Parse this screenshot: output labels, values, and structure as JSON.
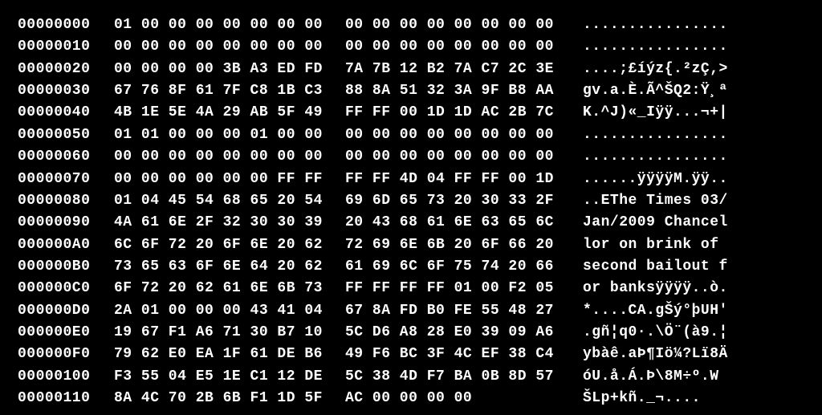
{
  "hexdump": {
    "rows": [
      {
        "offset": "00000000",
        "b1": "01 00 00 00 00 00 00 00",
        "b2": "00 00 00 00 00 00 00 00",
        "ascii": "................"
      },
      {
        "offset": "00000010",
        "b1": "00 00 00 00 00 00 00 00",
        "b2": "00 00 00 00 00 00 00 00",
        "ascii": "................"
      },
      {
        "offset": "00000020",
        "b1": "00 00 00 00 3B A3 ED FD",
        "b2": "7A 7B 12 B2 7A C7 2C 3E",
        "ascii": "....;£íýz{.²zÇ,>"
      },
      {
        "offset": "00000030",
        "b1": "67 76 8F 61 7F C8 1B C3",
        "b2": "88 8A 51 32 3A 9F B8 AA",
        "ascii": "gv.a.È.Ã^ŠQ2:Ÿ¸ª"
      },
      {
        "offset": "00000040",
        "b1": "4B 1E 5E 4A 29 AB 5F 49",
        "b2": "FF FF 00 1D 1D AC 2B 7C",
        "ascii": "K.^J)«_Iÿÿ...¬+|"
      },
      {
        "offset": "00000050",
        "b1": "01 01 00 00 00 01 00 00",
        "b2": "00 00 00 00 00 00 00 00",
        "ascii": "................"
      },
      {
        "offset": "00000060",
        "b1": "00 00 00 00 00 00 00 00",
        "b2": "00 00 00 00 00 00 00 00",
        "ascii": "................"
      },
      {
        "offset": "00000070",
        "b1": "00 00 00 00 00 00 FF FF",
        "b2": "FF FF 4D 04 FF FF 00 1D",
        "ascii": "......ÿÿÿÿM.ÿÿ.."
      },
      {
        "offset": "00000080",
        "b1": "01 04 45 54 68 65 20 54",
        "b2": "69 6D 65 73 20 30 33 2F",
        "ascii": "..EThe Times 03/"
      },
      {
        "offset": "00000090",
        "b1": "4A 61 6E 2F 32 30 30 39",
        "b2": "20 43 68 61 6E 63 65 6C",
        "ascii": "Jan/2009 Chancel"
      },
      {
        "offset": "000000A0",
        "b1": "6C 6F 72 20 6F 6E 20 62",
        "b2": "72 69 6E 6B 20 6F 66 20",
        "ascii": "lor on brink of "
      },
      {
        "offset": "000000B0",
        "b1": "73 65 63 6F 6E 64 20 62",
        "b2": "61 69 6C 6F 75 74 20 66",
        "ascii": "second bailout f"
      },
      {
        "offset": "000000C0",
        "b1": "6F 72 20 62 61 6E 6B 73",
        "b2": "FF FF FF FF 01 00 F2 05",
        "ascii": "or banksÿÿÿÿ..ò."
      },
      {
        "offset": "000000D0",
        "b1": "2A 01 00 00 00 43 41 04",
        "b2": "67 8A FD B0 FE 55 48 27",
        "ascii": "*....CA.gŠý°þUH'"
      },
      {
        "offset": "000000E0",
        "b1": "19 67 F1 A6 71 30 B7 10",
        "b2": "5C D6 A8 28 E0 39 09 A6",
        "ascii": ".gñ¦q0·.\\Ö¨(à9.¦"
      },
      {
        "offset": "000000F0",
        "b1": "79 62 E0 EA 1F 61 DE B6",
        "b2": "49 F6 BC 3F 4C EF 38 C4",
        "ascii": "ybàê.aÞ¶Iö¼?Lï8Ä"
      },
      {
        "offset": "00000100",
        "b1": "F3 55 04 E5 1E C1 12 DE",
        "b2": "5C 38 4D F7 BA 0B 8D 57",
        "ascii": "óU.å.Á.Þ\\8M÷º.W"
      },
      {
        "offset": "00000110",
        "b1": "8A 4C 70 2B 6B F1 1D 5F",
        "b2": "AC 00 00 00 00         ",
        "ascii": "ŠLp+kñ._¬...."
      }
    ]
  }
}
